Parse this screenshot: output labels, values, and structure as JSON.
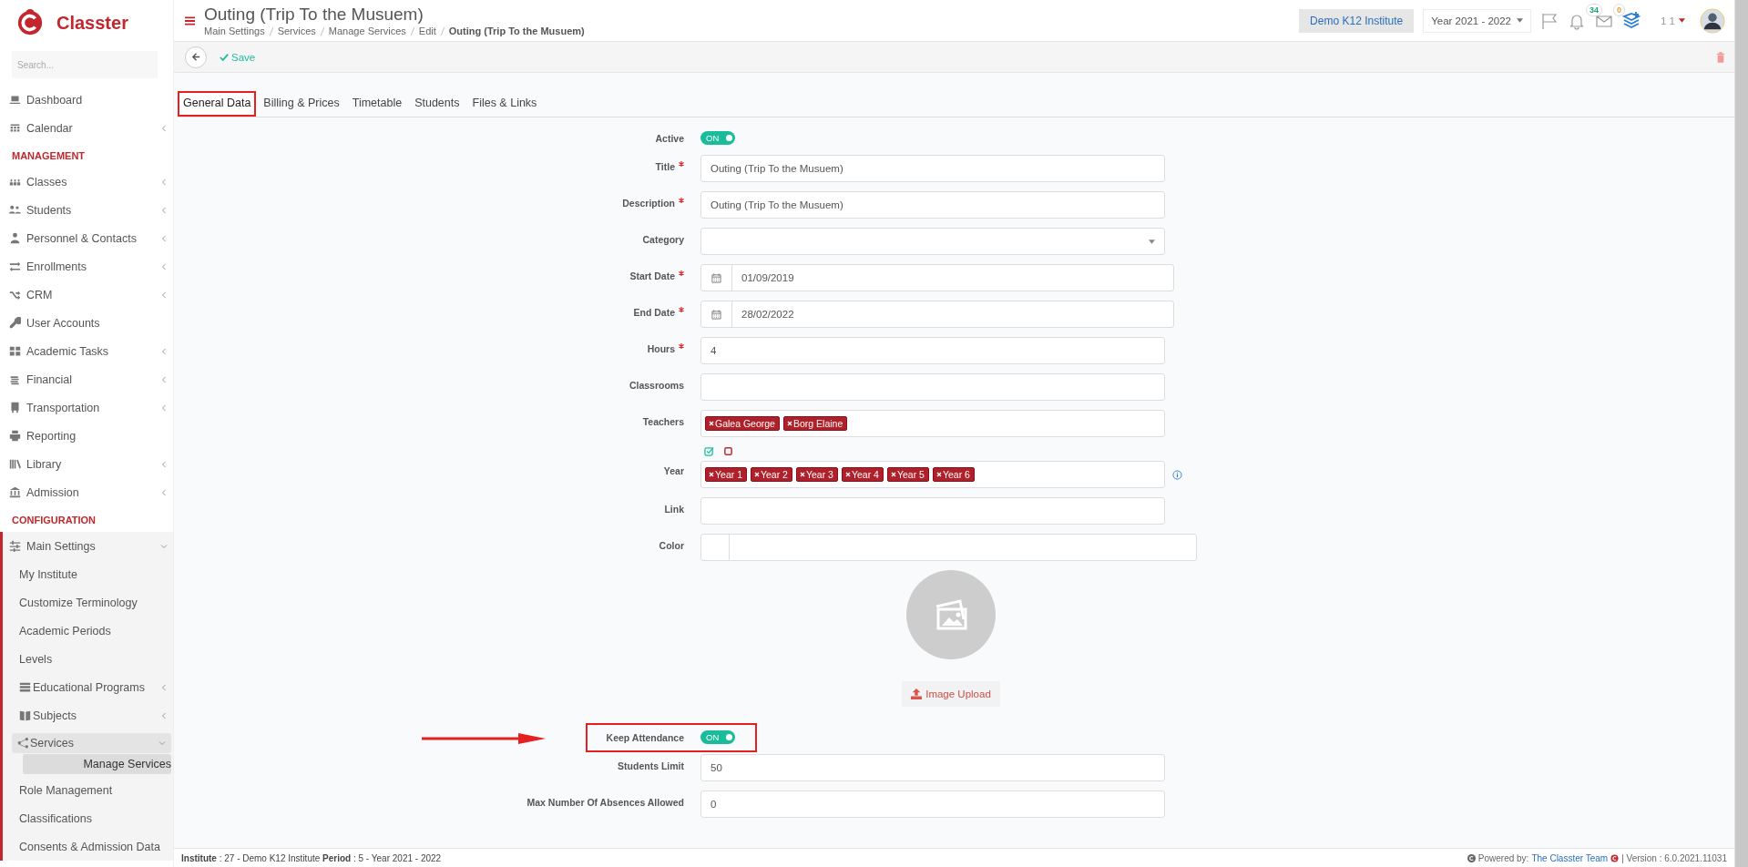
{
  "sidebar": {
    "logo": "Classter",
    "search": {
      "placeholder": "Search..."
    },
    "groups": [
      {
        "items": [
          {
            "label": "Dashboard",
            "has_submenu": false,
            "expanded": false,
            "selected": false
          },
          {
            "label": "Calendar",
            "has_submenu": true,
            "expanded": false,
            "selected": false
          }
        ]
      },
      {
        "heading": "MANAGEMENT",
        "items": [
          {
            "label": "Classes",
            "has_submenu": true,
            "expanded": false,
            "selected": false
          },
          {
            "label": "Students",
            "has_submenu": true,
            "expanded": false,
            "selected": false
          },
          {
            "label": "Personnel & Contacts",
            "has_submenu": true,
            "expanded": false,
            "selected": false
          },
          {
            "label": "Enrollments",
            "has_submenu": true,
            "expanded": false,
            "selected": false
          },
          {
            "label": "CRM",
            "has_submenu": true,
            "expanded": false,
            "selected": false
          },
          {
            "label": "User Accounts",
            "has_submenu": false,
            "expanded": false,
            "selected": false
          },
          {
            "label": "Academic Tasks",
            "has_submenu": true,
            "expanded": false,
            "selected": false
          },
          {
            "label": "Financial",
            "has_submenu": true,
            "expanded": false,
            "selected": false
          },
          {
            "label": "Transportation",
            "has_submenu": true,
            "expanded": false,
            "selected": false
          },
          {
            "label": "Reporting",
            "has_submenu": false,
            "expanded": false,
            "selected": false
          },
          {
            "label": "Library",
            "has_submenu": true,
            "expanded": false,
            "selected": false
          },
          {
            "label": "Admission",
            "has_submenu": true,
            "expanded": false,
            "selected": false
          }
        ]
      },
      {
        "heading": "CONFIGURATION",
        "items": [
          {
            "label": "Main Settings",
            "has_submenu": true,
            "expanded": true,
            "selected": false,
            "children": [
              {
                "label": "My Institute",
                "has_submenu": false,
                "expanded": false,
                "selected": false
              },
              {
                "label": "Customize Terminology",
                "has_submenu": false,
                "expanded": false,
                "selected": false
              },
              {
                "label": "Academic Periods",
                "has_submenu": false,
                "expanded": false,
                "selected": false
              },
              {
                "label": "Levels",
                "has_submenu": false,
                "expanded": false,
                "selected": false
              },
              {
                "label": "Educational Programs",
                "has_submenu": true,
                "expanded": false,
                "selected": false
              },
              {
                "label": "Subjects",
                "has_submenu": true,
                "expanded": false,
                "selected": false
              },
              {
                "label": "Services",
                "has_submenu": true,
                "expanded": true,
                "selected": false,
                "children": [
                  {
                    "label": "Manage Services",
                    "selected": true
                  }
                ]
              },
              {
                "label": "Role Management",
                "has_submenu": false,
                "expanded": false,
                "selected": false
              },
              {
                "label": "Classifications",
                "has_submenu": false,
                "expanded": false,
                "selected": false
              },
              {
                "label": "Consents & Admission Data",
                "has_submenu": false,
                "expanded": false,
                "selected": false
              }
            ]
          }
        ]
      }
    ]
  },
  "header": {
    "title": "Outing (Trip To the Musuem)",
    "breadcrumb": [
      "Main Settings",
      "Services",
      "Manage Services",
      "Edit",
      "Outing (Trip To the Musuem)"
    ],
    "institute": "Demo K12 Institute",
    "year": "Year 2021 - 2022",
    "notifications": "34",
    "messages": "0",
    "user": "1 1"
  },
  "toolbar": {
    "save": "Save"
  },
  "tabs": [
    {
      "label": "General Data",
      "selected": true,
      "highlighted": true
    },
    {
      "label": "Billing & Prices",
      "selected": false,
      "highlighted": false
    },
    {
      "label": "Timetable",
      "selected": false,
      "highlighted": false
    },
    {
      "label": "Students",
      "selected": false,
      "highlighted": false
    },
    {
      "label": "Files & Links",
      "selected": false,
      "highlighted": false
    }
  ],
  "form": {
    "fields": [
      {
        "kind": "toggle",
        "label": "Active",
        "on": true,
        "text": "ON"
      },
      {
        "kind": "text",
        "label": "Title",
        "required": true,
        "value": "Outing (Trip To the Musuem)"
      },
      {
        "kind": "text",
        "label": "Description",
        "required": true,
        "value": "Outing (Trip To the Musuem)"
      },
      {
        "kind": "select",
        "label": "Category"
      },
      {
        "kind": "date",
        "label": "Start Date",
        "required": true,
        "value": "01/09/2019"
      },
      {
        "kind": "date",
        "label": "End Date",
        "required": true,
        "value": "28/02/2022"
      },
      {
        "kind": "text",
        "label": "Hours",
        "required": true,
        "value": "4"
      },
      {
        "kind": "tags",
        "label": "Classrooms"
      },
      {
        "kind": "tags",
        "label": "Teachers",
        "tags": [
          "Galea George",
          "Borg Elaine"
        ]
      },
      {
        "kind": "tags",
        "label": "Year",
        "bulk_select": true,
        "info": true,
        "tags": [
          "Year 1",
          "Year 2",
          "Year 3",
          "Year 4",
          "Year 5",
          "Year 6"
        ]
      },
      {
        "kind": "text",
        "label": "Link"
      },
      {
        "kind": "color",
        "label": "Color"
      },
      {
        "kind": "image",
        "button": "Image Upload"
      },
      {
        "kind": "toggle",
        "label": "Keep Attendance",
        "on": true,
        "text": "ON",
        "highlighted": true
      },
      {
        "kind": "text",
        "label": "Students Limit",
        "value": "50"
      },
      {
        "kind": "text",
        "label": "Max Number Of Absences Allowed",
        "value": "0"
      }
    ]
  },
  "footer": {
    "info": "**Institute** : 27 - Demo K12 Institute **Period** : 5 - Year 2021 - 2022",
    "powered_by": "Powered by:",
    "team": "The Classter Team",
    "version": "| Version : 6.0.2021.11031"
  }
}
